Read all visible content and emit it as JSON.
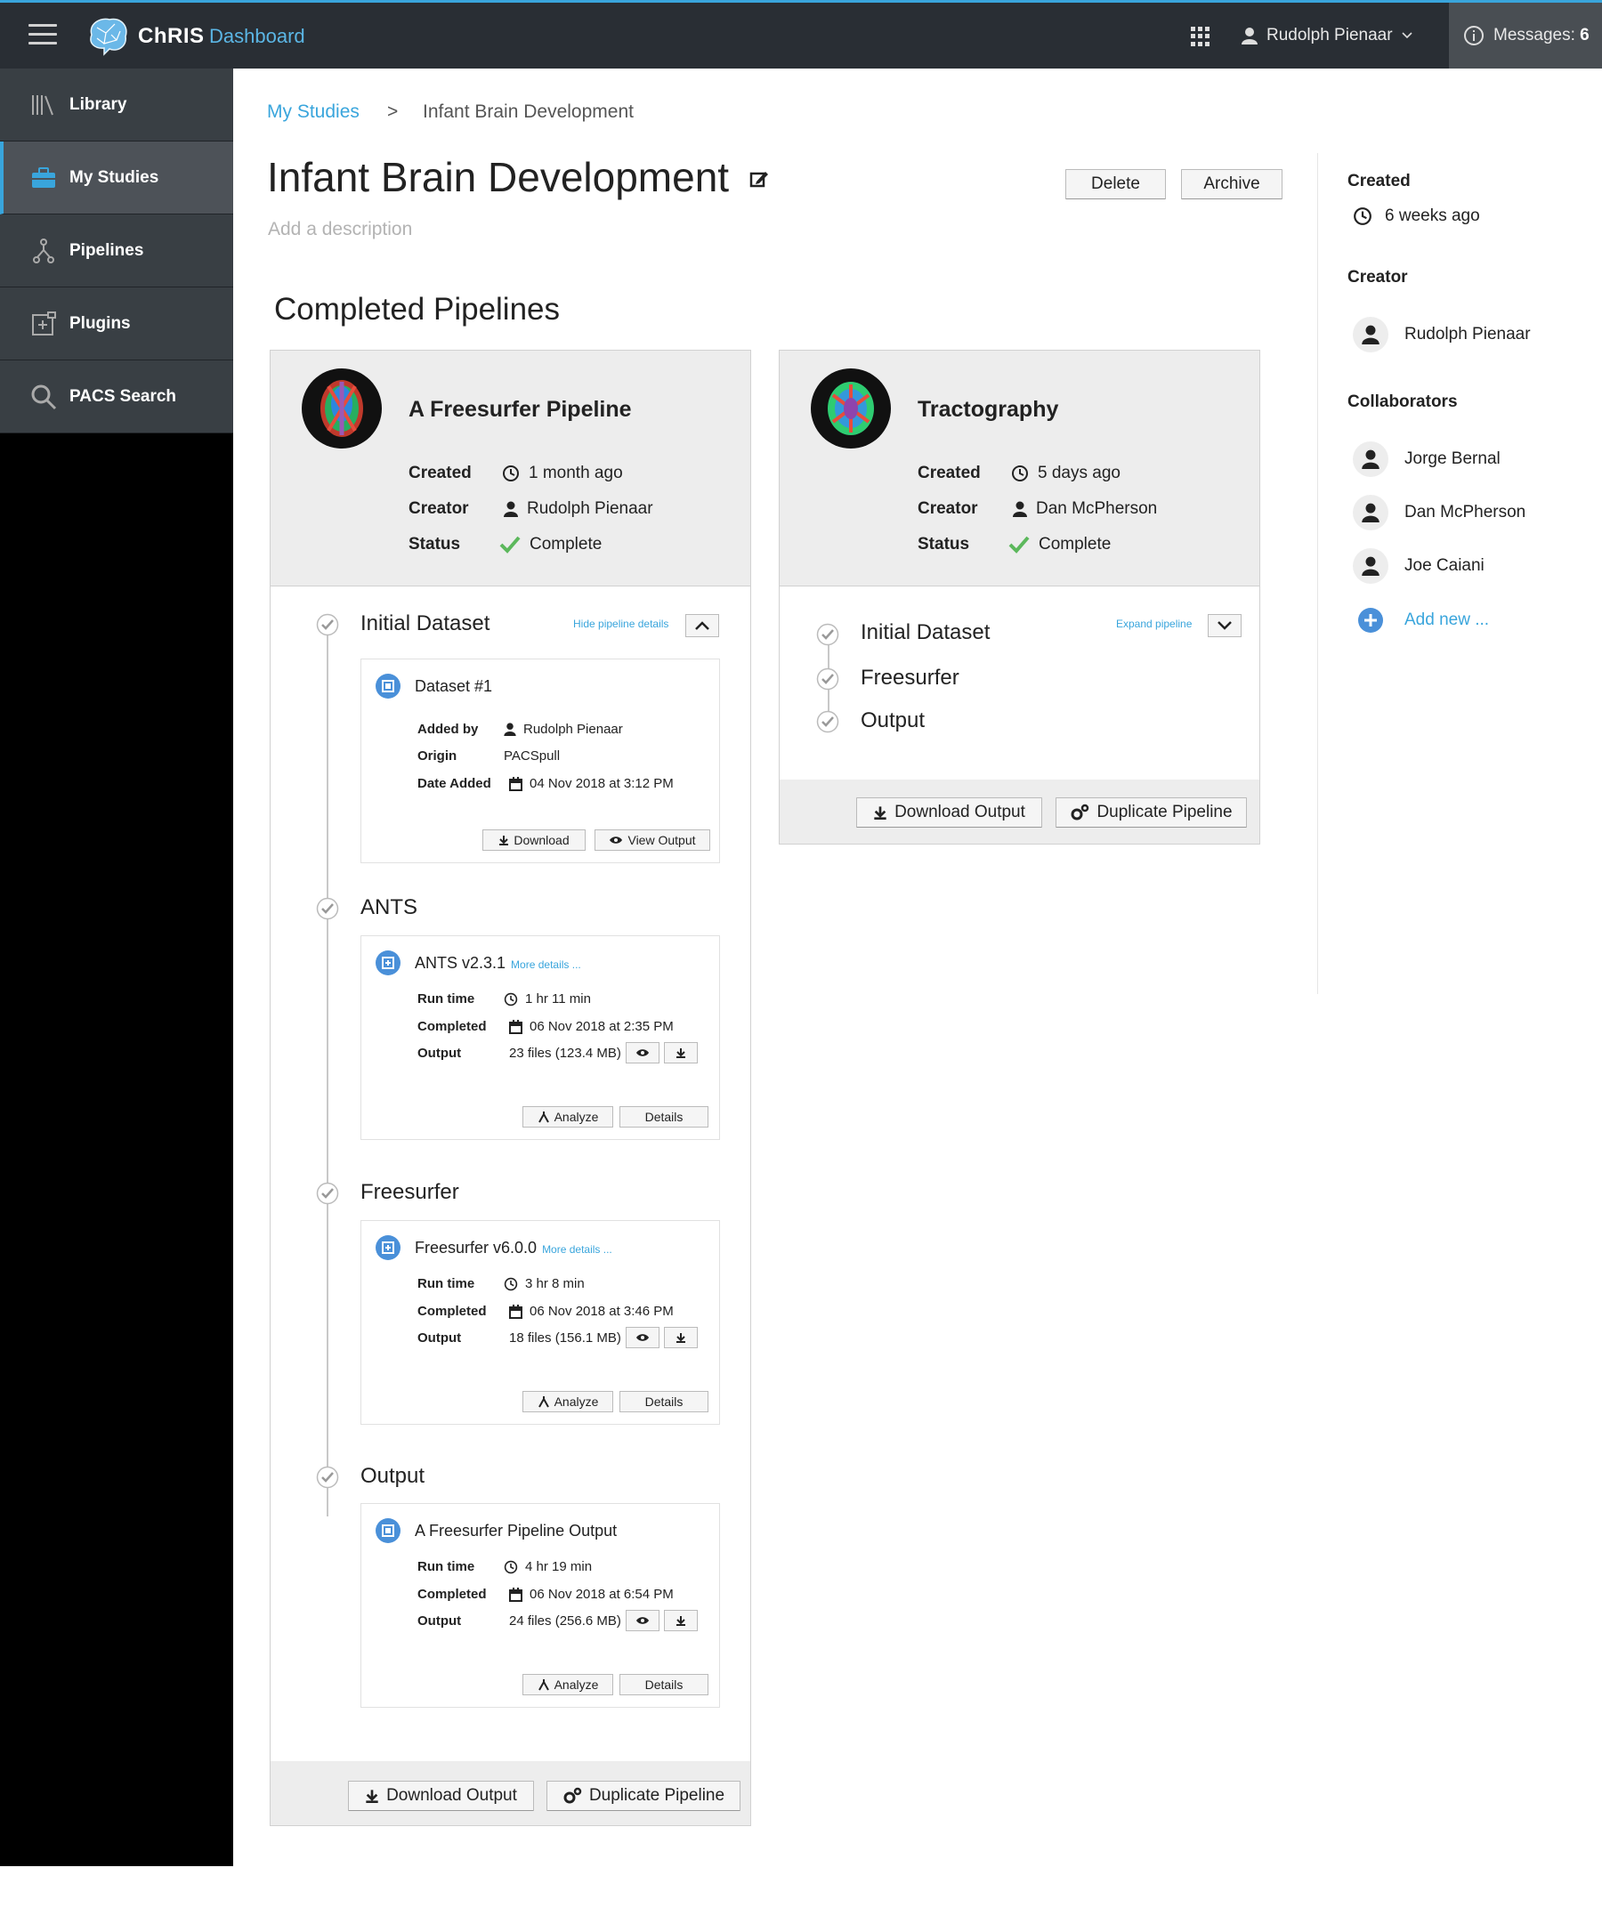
{
  "header": {
    "brand": "ChRIS",
    "brand_sub": "Dashboard",
    "user_name": "Rudolph Pienaar",
    "messages_label": "Messages:",
    "messages_count": "6"
  },
  "sidebar": {
    "items": [
      {
        "label": "Library",
        "icon": "library-icon"
      },
      {
        "label": "My Studies",
        "icon": "briefcase-icon",
        "active": true
      },
      {
        "label": "Pipelines",
        "icon": "pipeline-icon"
      },
      {
        "label": "Plugins",
        "icon": "plugin-icon"
      },
      {
        "label": "PACS Search",
        "icon": "search-icon"
      }
    ]
  },
  "breadcrumb": {
    "parent": "My Studies",
    "separator": ">",
    "current": "Infant Brain Development"
  },
  "study": {
    "title": "Infant Brain Development",
    "description_placeholder": "Add a description",
    "delete_label": "Delete",
    "archive_label": "Archive",
    "section_title": "Completed Pipelines"
  },
  "pipelines": [
    {
      "name": "A Freesurfer Pipeline",
      "created_label": "Created",
      "created": "1 month ago",
      "creator_label": "Creator",
      "creator": "Rudolph Pienaar",
      "status_label": "Status",
      "status": "Complete",
      "toggle_label": "Hide pipeline details",
      "steps": [
        {
          "name": "Initial Dataset",
          "card": {
            "title": "Dataset #1",
            "r1_label": "Added by",
            "r1": "Rudolph Pienaar",
            "r2_label": "Origin",
            "r2": "PACSpull",
            "r3_label": "Date Added",
            "r3": "04 Nov 2018 at 3:12 PM",
            "btn1": "Download",
            "btn2": "View Output"
          }
        },
        {
          "name": "ANTS",
          "card": {
            "title": "ANTS  v2.3.1",
            "more": "More details ...",
            "r1_label": "Run time",
            "r1": "1 hr 11 min",
            "r2_label": "Completed",
            "r2": "06 Nov 2018 at 2:35 PM",
            "r3_label": "Output",
            "r3": "23 files (123.4 MB)",
            "btn1": "Analyze",
            "btn2": "Details"
          }
        },
        {
          "name": "Freesurfer",
          "card": {
            "title": "Freesurfer v6.0.0",
            "more": "More details ...",
            "r1_label": "Run time",
            "r1": "3 hr 8 min",
            "r2_label": "Completed",
            "r2": "06 Nov 2018 at 3:46 PM",
            "r3_label": "Output",
            "r3": "18 files (156.1 MB)",
            "btn1": "Analyze",
            "btn2": "Details"
          }
        },
        {
          "name": "Output",
          "card": {
            "title": "A Freesurfer Pipeline Output",
            "r1_label": "Run time",
            "r1": "4 hr 19 min",
            "r2_label": "Completed",
            "r2": "06 Nov 2018 at 6:54 PM",
            "r3_label": "Output",
            "r3": "24 files (256.6 MB)",
            "btn1": "Analyze",
            "btn2": "Details"
          }
        }
      ],
      "download_label": "Download Output",
      "duplicate_label": "Duplicate Pipeline"
    },
    {
      "name": "Tractography",
      "created_label": "Created",
      "created": "5 days ago",
      "creator_label": "Creator",
      "creator": "Dan McPherson",
      "status_label": "Status",
      "status": "Complete",
      "toggle_label": "Expand pipeline",
      "steps": [
        {
          "name": "Initial Dataset"
        },
        {
          "name": "Freesurfer"
        },
        {
          "name": "Output"
        }
      ],
      "download_label": "Download Output",
      "duplicate_label": "Duplicate Pipeline"
    }
  ],
  "details": {
    "created_label": "Created",
    "created": "6 weeks ago",
    "creator_label": "Creator",
    "creator": "Rudolph Pienaar",
    "collaborators_label": "Collaborators",
    "collaborators": [
      "Jorge Bernal",
      "Dan McPherson",
      "Joe Caiani"
    ],
    "add_new": "Add new ..."
  },
  "colors": {
    "accent": "#39a5dc",
    "topbar": "#292e34",
    "sidebar": "#393f44",
    "success": "#5cb85c"
  }
}
